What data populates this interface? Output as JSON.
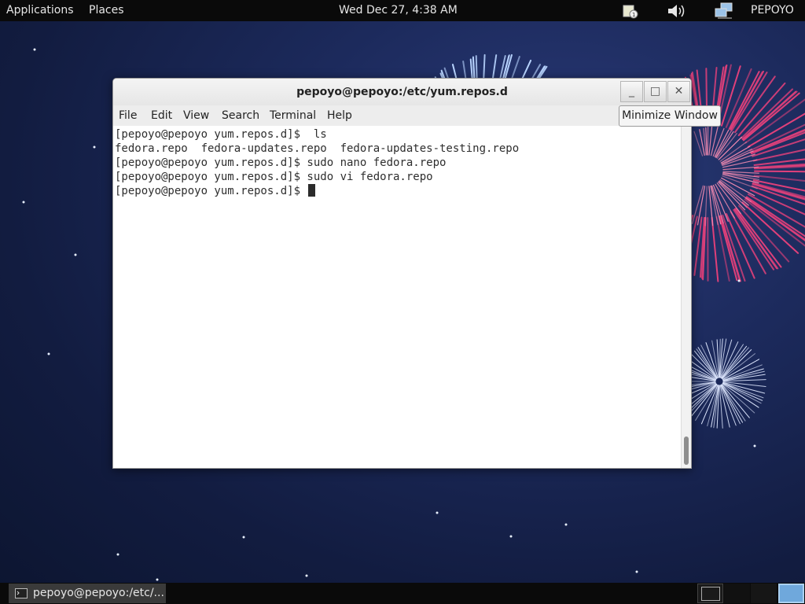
{
  "top_panel": {
    "applications": "Applications",
    "places": "Places",
    "clock": "Wed Dec 27,  4:38 AM",
    "user": "PEPOYO",
    "icons": [
      "notification-icon",
      "volume-icon",
      "network-icon"
    ]
  },
  "window": {
    "title": "pepoyo@pepoyo:/etc/yum.repos.d",
    "buttons": {
      "minimize": "_",
      "maximize": "□",
      "close": "✕"
    },
    "menu": [
      "File",
      "Edit",
      "View",
      "Search",
      "Terminal",
      "Help"
    ],
    "terminal_lines": [
      "[pepoyo@pepoyo yum.repos.d]$  ls",
      "fedora.repo  fedora-updates.repo  fedora-updates-testing.repo",
      "[pepoyo@pepoyo yum.repos.d]$ sudo nano fedora.repo",
      "[pepoyo@pepoyo yum.repos.d]$ sudo vi fedora.repo",
      "[pepoyo@pepoyo yum.repos.d]$ "
    ]
  },
  "tooltip": "Minimize Window",
  "bottom_panel": {
    "task_label": "pepoyo@pepoyo:/etc/...",
    "workspaces": 4,
    "active_workspace": 4
  },
  "colors": {
    "panel": "#0a0a0a",
    "desktop": "#1c2a5c",
    "firework_pink": "#e0407a",
    "active_workspace": "#6fa8dc"
  }
}
